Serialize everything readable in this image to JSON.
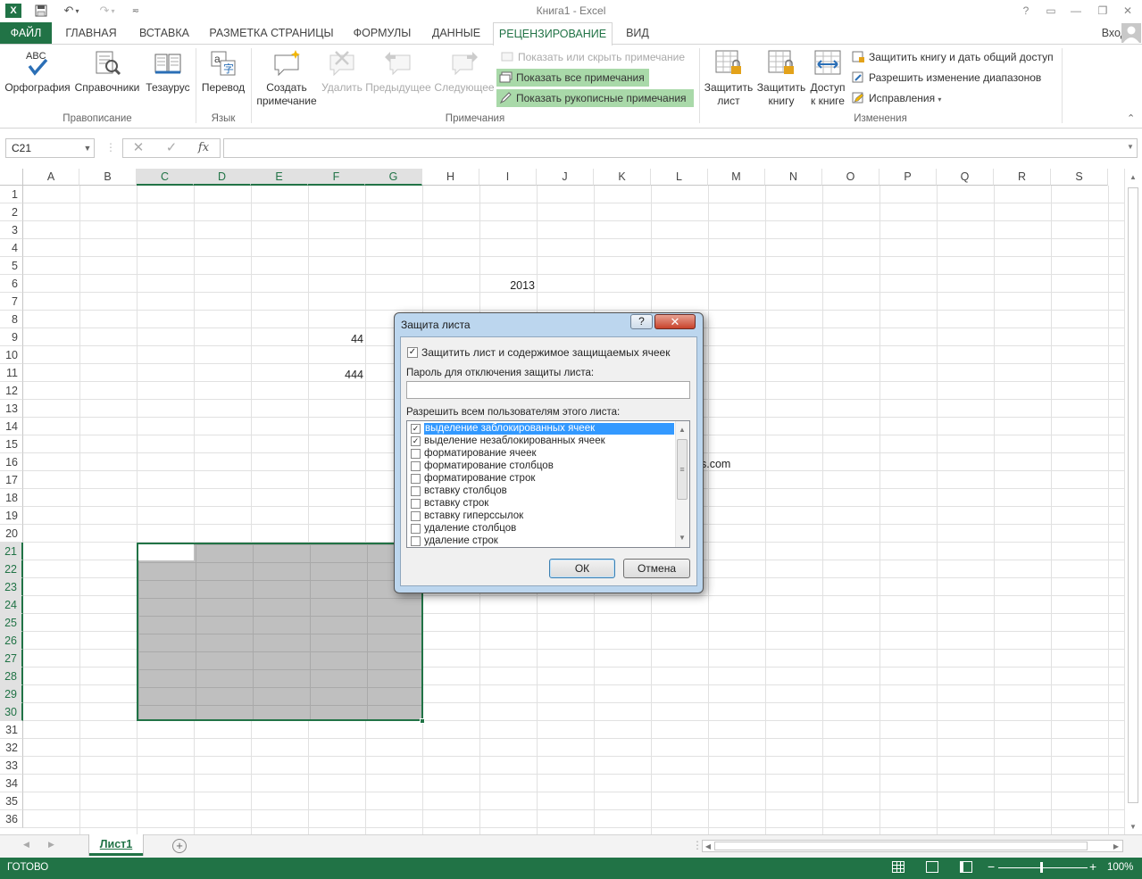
{
  "window": {
    "title": "Книга1 - Excel",
    "sign_in": "Вход"
  },
  "colors": {
    "accent": "#217346",
    "dialog_frame": "#bcd6ee",
    "list_highlight": "#3399ff"
  },
  "tabs": [
    {
      "label": "ФАЙЛ"
    },
    {
      "label": "ГЛАВНАЯ"
    },
    {
      "label": "ВСТАВКА"
    },
    {
      "label": "РАЗМЕТКА СТРАНИЦЫ"
    },
    {
      "label": "ФОРМУЛЫ"
    },
    {
      "label": "ДАННЫЕ"
    },
    {
      "label": "РЕЦЕНЗИРОВАНИЕ",
      "active": true
    },
    {
      "label": "ВИД"
    }
  ],
  "ribbon": {
    "proofing": {
      "spelling": "Орфография",
      "research": "Справочники",
      "thesaurus": "Тезаурус",
      "label": "Правописание",
      "abc": "ABC"
    },
    "language": {
      "translate": "Перевод",
      "label": "Язык"
    },
    "comments": {
      "new_line1": "Создать",
      "new_line2": "примечание",
      "delete": "Удалить",
      "previous": "Предыдущее",
      "next": "Следующее",
      "show_hide": "Показать или скрыть примечание",
      "show_all": "Показать все примечания",
      "show_ink": "Показать рукописные примечания",
      "label": "Примечания"
    },
    "changes": {
      "protect_sheet_1": "Защитить",
      "protect_sheet_2": "лист",
      "protect_book_1": "Защитить",
      "protect_book_2": "книгу",
      "share_1": "Доступ",
      "share_2": "к книге",
      "protect_share": "Защитить книгу и дать общий доступ",
      "allow_ranges": "Разрешить изменение диапазонов",
      "track": "Исправления",
      "label": "Изменения"
    }
  },
  "formula_bar": {
    "name_box": "C21",
    "fx": "fx",
    "cancel": "✕",
    "enter": "✓",
    "value": ""
  },
  "grid": {
    "columns": [
      "A",
      "B",
      "C",
      "D",
      "E",
      "F",
      "G",
      "H",
      "I",
      "J",
      "K",
      "L",
      "M",
      "N",
      "O",
      "P",
      "Q",
      "R",
      "S"
    ],
    "rows": [
      "1",
      "2",
      "3",
      "4",
      "5",
      "6",
      "7",
      "8",
      "9",
      "10",
      "11",
      "12",
      "13",
      "14",
      "15",
      "16",
      "17",
      "18",
      "19",
      "20",
      "21",
      "22",
      "23",
      "24",
      "25",
      "26",
      "27",
      "28",
      "29",
      "30",
      "31",
      "32",
      "33",
      "34",
      "35",
      "36"
    ],
    "cells": {
      "I6": "2013",
      "F9": "44",
      "F11": "444",
      "L16": "s.com"
    }
  },
  "sheet_tabs": {
    "active": "Лист1"
  },
  "status_bar": {
    "text": "ГОТОВО",
    "zoom": "100%"
  },
  "dialog": {
    "title": "Защита листа",
    "help": "?",
    "close": "✕",
    "protect_checkbox": "Защитить лист и содержимое защищаемых ячеек",
    "protect_checked": true,
    "password_label": "Пароль для отключения защиты листа:",
    "password_value": "",
    "allow_label": "Разрешить всем пользователям этого листа:",
    "options": [
      {
        "label": "выделение заблокированных ячеек",
        "checked": true
      },
      {
        "label": "выделение незаблокированных ячеек",
        "checked": true
      },
      {
        "label": "форматирование ячеек",
        "checked": false
      },
      {
        "label": "форматирование столбцов",
        "checked": false
      },
      {
        "label": "форматирование строк",
        "checked": false
      },
      {
        "label": "вставку столбцов",
        "checked": false
      },
      {
        "label": "вставку строк",
        "checked": false
      },
      {
        "label": "вставку гиперссылок",
        "checked": false
      },
      {
        "label": "удаление столбцов",
        "checked": false
      },
      {
        "label": "удаление строк",
        "checked": false
      }
    ],
    "ok": "ОК",
    "cancel": "Отмена"
  }
}
